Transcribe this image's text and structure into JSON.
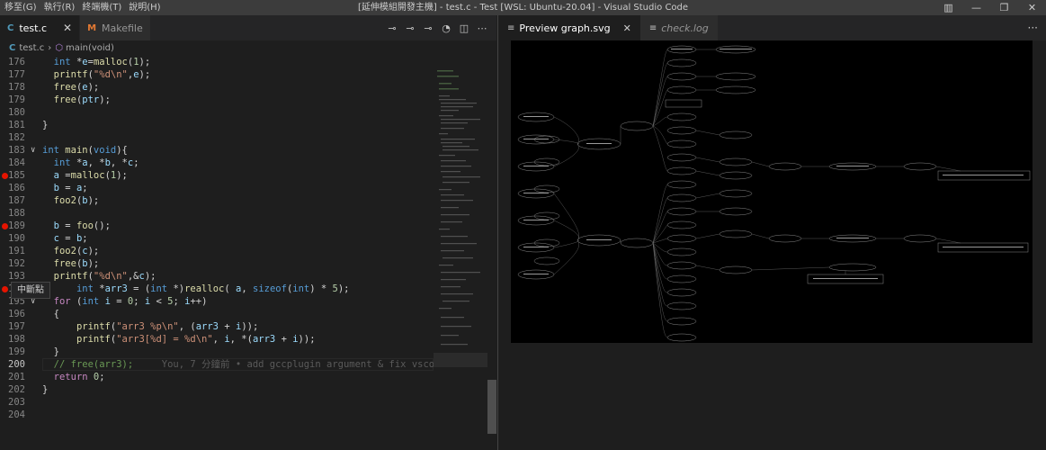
{
  "menu": [
    "移至(G)",
    "執行(R)",
    "終端機(T)",
    "說明(H)"
  ],
  "window_title": "[延伸模組開發主機] - test.c - Test [WSL: Ubuntu-20.04] - Visual Studio Code",
  "left_tabs": [
    {
      "icon": "C",
      "label": "test.c",
      "close": "✕"
    },
    {
      "icon": "M",
      "label": "Makefile"
    }
  ],
  "breadcrumb": {
    "file": "test.c",
    "symbol": "main(void)"
  },
  "tooltip": "中斷點",
  "blame": "You, 7 分鐘前 • add gccplugin argument & fix vscode",
  "line_numbers": [
    "176",
    "177",
    "178",
    "179",
    "180",
    "181",
    "182",
    "183",
    "184",
    "185",
    "186",
    "187",
    "188",
    "189",
    "190",
    "191",
    "192",
    "193",
    "194",
    "195",
    "196",
    "197",
    "198",
    "199",
    "200",
    "201",
    "202",
    "203",
    "204"
  ],
  "right_tabs": [
    {
      "icon": "≡",
      "label": "Preview graph.svg",
      "close": "✕"
    },
    {
      "icon": "≡",
      "label": "check.log"
    }
  ],
  "more": "···"
}
